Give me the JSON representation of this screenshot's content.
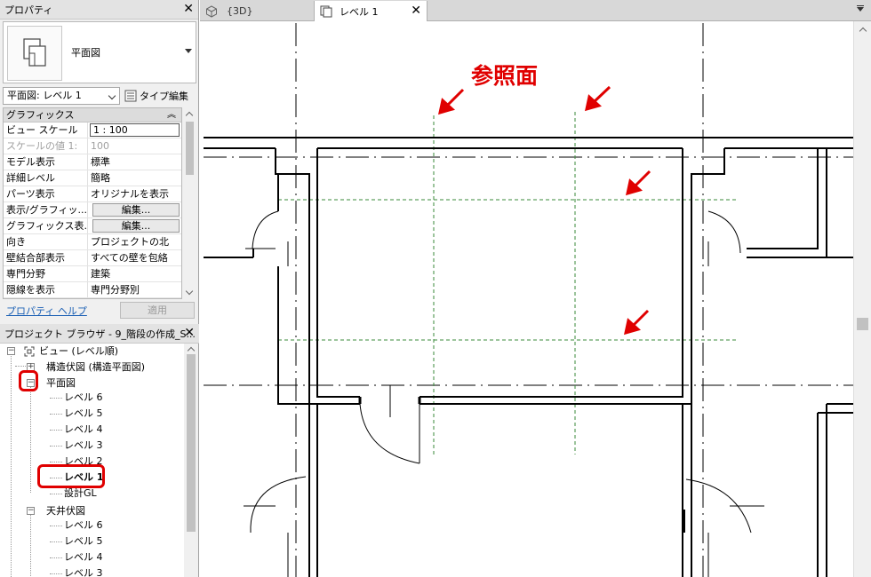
{
  "properties_panel": {
    "title": "プロパティ",
    "type_name": "平面図",
    "instance_selector": "平面図: レベル 1",
    "type_edit_label": "タイプ編集",
    "group": "グラフィックス",
    "rows": [
      {
        "key": "ビュー スケール",
        "value": "1 : 100"
      },
      {
        "key": "スケールの値    1:",
        "value": "100"
      },
      {
        "key": "モデル表示",
        "value": "標準"
      },
      {
        "key": "詳細レベル",
        "value": "簡略"
      },
      {
        "key": "パーツ表示",
        "value": "オリジナルを表示"
      },
      {
        "key": "表示/グラフィッ...",
        "value": "編集..."
      },
      {
        "key": "グラフィックス表...",
        "value": "編集..."
      },
      {
        "key": "向き",
        "value": "プロジェクトの北"
      },
      {
        "key": "壁結合部表示",
        "value": "すべての壁を包絡"
      },
      {
        "key": "専門分野",
        "value": "建築"
      },
      {
        "key": "隠線を表示",
        "value": "専門分野別"
      }
    ],
    "help_link": "プロパティ ヘルプ",
    "apply_button": "適用"
  },
  "project_browser": {
    "title": "プロジェクト ブラウザ - 9_階段の作成_S...",
    "root": "ビュー (レベル順)",
    "structural_plans": "構造伏図 (構造平面図)",
    "floor_plans": "平面図",
    "floor_plan_items": [
      "レベル 6",
      "レベル 5",
      "レベル 4",
      "レベル 3",
      "レベル 2",
      "レベル 1",
      "設計GL"
    ],
    "ceiling_plans": "天井伏図",
    "ceiling_plan_items": [
      "レベル 6",
      "レベル 5",
      "レベル 4",
      "レベル 3"
    ],
    "selected": "レベル 1"
  },
  "tabs": [
    {
      "label": "{3D}",
      "icon": "3d-view-icon"
    },
    {
      "label": "レベル 1",
      "icon": "floor-plan-icon",
      "active": true
    }
  ],
  "annotation": {
    "label": "参照面",
    "color": "#e00000"
  },
  "colors": {
    "reference_plane": "#3a8a3a",
    "highlight": "#e00000",
    "link": "#1a5fb4"
  }
}
